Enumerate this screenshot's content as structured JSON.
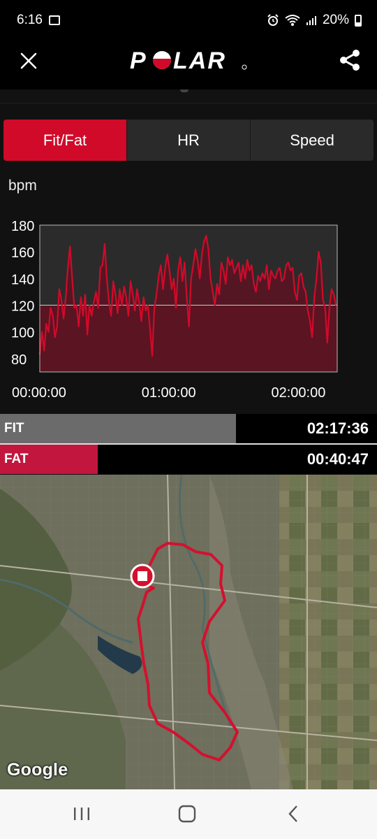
{
  "status": {
    "time": "6:16",
    "battery": "20%"
  },
  "app": {
    "logo_text": "POLAR"
  },
  "tabs": [
    {
      "label": "Fit/Fat",
      "active": true
    },
    {
      "label": "HR",
      "active": false
    },
    {
      "label": "Speed",
      "active": false
    }
  ],
  "chart_data": {
    "type": "area",
    "ylabel": "bpm",
    "ylim": [
      70,
      180
    ],
    "yticks": [
      "180",
      "160",
      "140",
      "120",
      "100",
      "80"
    ],
    "xticks": [
      "00:00:00",
      "01:00:00",
      "02:00:00"
    ],
    "xlim_minutes": [
      0,
      137.6
    ],
    "threshold": 120,
    "colors": {
      "line": "#d10a2a",
      "fill": "#5a1422",
      "upper_bg": "#2b2b2b"
    },
    "series": [
      {
        "x": [
          0,
          1,
          2,
          3,
          4,
          5,
          6,
          7,
          8,
          9,
          10,
          11,
          12,
          13,
          14,
          15,
          16,
          17,
          18,
          19,
          20,
          21,
          22,
          23,
          24,
          25,
          26,
          27,
          28,
          29,
          30,
          31,
          32,
          33,
          34,
          35,
          36,
          37,
          38,
          39,
          40,
          41,
          42,
          43,
          44,
          45,
          46,
          47,
          48,
          49,
          50,
          51,
          52,
          53,
          54,
          55,
          56,
          57,
          58,
          59,
          60,
          61,
          62,
          63,
          64,
          65,
          66,
          67,
          68,
          69,
          70,
          71,
          72,
          73,
          74,
          75,
          76,
          77,
          78,
          79,
          80,
          81,
          82,
          83,
          84,
          85,
          86,
          87,
          88,
          89,
          90,
          91,
          92,
          93,
          94,
          95,
          96,
          97,
          98,
          99,
          100,
          101,
          102,
          103,
          104,
          105,
          106,
          107,
          108,
          109,
          110,
          111,
          112,
          113,
          114,
          115,
          116,
          117,
          118,
          119,
          120,
          121,
          122,
          123,
          124,
          125,
          126,
          127,
          128,
          129,
          130,
          131,
          132,
          133,
          134,
          135,
          136,
          137
        ],
        "values": [
          83,
          100,
          86,
          106,
          100,
          118,
          112,
          96,
          104,
          132,
          124,
          110,
          126,
          148,
          164,
          140,
          118,
          120,
          104,
          126,
          112,
          128,
          98,
          120,
          112,
          122,
          130,
          118,
          148,
          150,
          166,
          140,
          122,
          112,
          138,
          128,
          114,
          132,
          120,
          134,
          126,
          112,
          138,
          128,
          116,
          132,
          122,
          108,
          126,
          116,
          120,
          102,
          82,
          118,
          128,
          142,
          150,
          132,
          148,
          158,
          146,
          132,
          140,
          118,
          146,
          156,
          138,
          152,
          126,
          104,
          140,
          150,
          162,
          154,
          140,
          158,
          168,
          172,
          162,
          140,
          130,
          120,
          136,
          128,
          152,
          146,
          136,
          156,
          150,
          154,
          144,
          148,
          152,
          138,
          150,
          140,
          154,
          146,
          150,
          136,
          130,
          142,
          138,
          144,
          140,
          150,
          132,
          146,
          142,
          140,
          146,
          148,
          138,
          140,
          150,
          152,
          146,
          148,
          130,
          124,
          142,
          144,
          134,
          130,
          116,
          108,
          96,
          126,
          140,
          160,
          152,
          124,
          118,
          92,
          118,
          132,
          128,
          120
        ]
      }
    ]
  },
  "fitfat": {
    "fit_label": "FIT",
    "fit_time": "02:17:36",
    "fit_fraction": 0.625,
    "fat_label": "FAT",
    "fat_time": "00:40:47",
    "fat_fraction": 0.26
  },
  "map": {
    "attribution": "Google"
  }
}
